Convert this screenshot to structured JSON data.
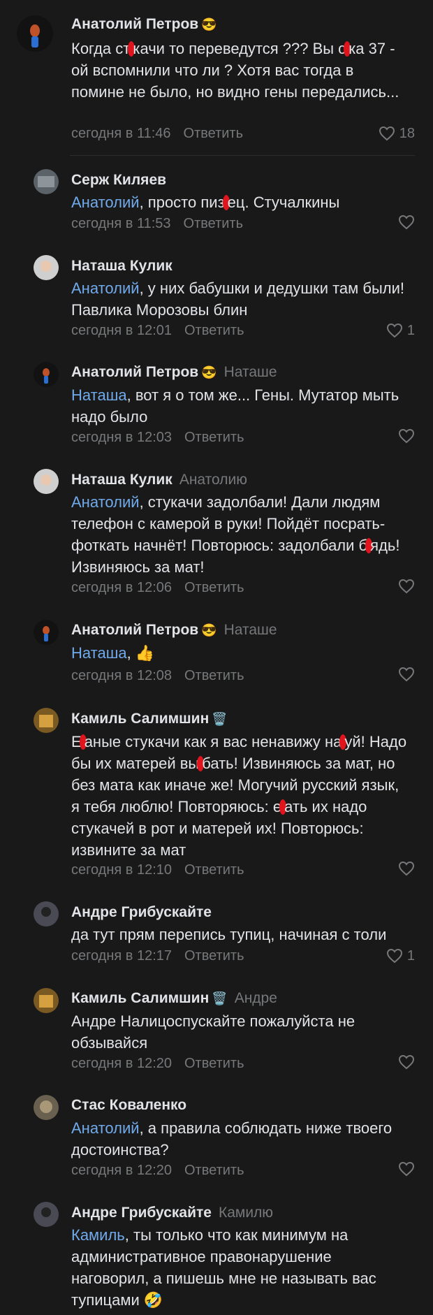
{
  "comments": [
    {
      "author": "Анатолий Петров",
      "badge": "😎",
      "reply_to": "",
      "mention": "",
      "text_before": "Когда ст",
      "redacted_a": "у",
      "text_mid": "качи то переведутся ??? Вы с",
      "redacted_b": "у",
      "text_after": "ка 37 - ой вспомнили что ли ? Хотя вас тогда в помине не было, но видно гены передались...",
      "time": "сегодня в 11:46",
      "answer": "Ответить",
      "likes": "18",
      "avatar": "user-avatar"
    },
    {
      "author": "Серж Киляев",
      "badge": "",
      "reply_to": "",
      "mention": "Анатолий",
      "text": ", просто пиз",
      "redacted": "д",
      "text_after": "ец. Стучалкины",
      "time": "сегодня в 11:53",
      "answer": "Ответить",
      "likes": "",
      "avatar": "user-avatar"
    },
    {
      "author": "Наташа Кулик",
      "badge": "",
      "reply_to": "",
      "mention": "Анатолий",
      "text": ", у них бабушки и дедушки там были! Павлика Морозовы блин",
      "time": "сегодня в 12:01",
      "answer": "Ответить",
      "likes": "1",
      "avatar": "user-avatar"
    },
    {
      "author": "Анатолий Петров",
      "badge": "😎",
      "reply_to": "Наташе",
      "mention": "Наташа",
      "text": ", вот я о том же... Гены. Мутатор мыть надо было",
      "time": "сегодня в 12:03",
      "answer": "Ответить",
      "likes": "",
      "avatar": "user-avatar"
    },
    {
      "author": "Наташа Кулик",
      "badge": "",
      "reply_to": "Анатолию",
      "mention": "Анатолий",
      "text": ", стукачи задолбали! Дали людям телефон с камерой в руки! Пойдёт посрать- фоткать начнёт! Повторюсь: задолбали б",
      "redacted": "л",
      "text_after": "ядь! Извиняюсь за мат!",
      "time": "сегодня в 12:06",
      "answer": "Ответить",
      "likes": "",
      "avatar": "user-avatar"
    },
    {
      "author": "Анатолий Петров",
      "badge": "😎",
      "reply_to": "Наташе",
      "mention": "Наташа",
      "text": ", 👍",
      "time": "сегодня в 12:08",
      "answer": "Ответить",
      "likes": "",
      "avatar": "user-avatar"
    },
    {
      "author": "Камиль Салимшин",
      "badge": "🗑️",
      "reply_to": "",
      "mention": "",
      "text": "Е",
      "redacted": "б",
      "text_after": "аные стукачи как я вас ненавижу на",
      "redacted2": "х",
      "text_after2": "уй! Надо бы их матерей вы",
      "redacted3": "е",
      "text_after3": "бать! Извиняюсь за мат, но без мата как иначе же! Могучий русский язык, я тебя люблю! Повторяюсь: е",
      "redacted4": "б",
      "text_after4": "ать их надо стукачей в рот и матерей их! Повторюсь: извините за мат",
      "time": "сегодня в 12:10",
      "answer": "Ответить",
      "likes": "",
      "avatar": "user-avatar"
    },
    {
      "author": "Андре Грибускайте",
      "badge": "",
      "reply_to": "",
      "mention": "",
      "text": "да тут прям перепись тупиц, начиная с толи",
      "time": "сегодня в 12:17",
      "answer": "Ответить",
      "likes": "1",
      "avatar": "user-avatar"
    },
    {
      "author": "Камиль Салимшин",
      "badge": "🗑️",
      "reply_to": "Андре",
      "mention": "",
      "text": "Андре Налицоспускайте пожалуйста не обзывайся",
      "time": "сегодня в 12:20",
      "answer": "Ответить",
      "likes": "",
      "avatar": "user-avatar"
    },
    {
      "author": "Стас Коваленко",
      "badge": "",
      "reply_to": "",
      "mention": "Анатолий",
      "text": ", а правила соблюдать ниже твоего достоинства?",
      "time": "сегодня в 12:20",
      "answer": "Ответить",
      "likes": "",
      "avatar": "user-avatar"
    },
    {
      "author": "Андре Грибускайте",
      "badge": "",
      "reply_to": "Камилю",
      "mention": "Камиль",
      "text": ", ты только что как минимум на административное правонарушение наговорил, а пишешь мне не называть вас тупицами 🤣",
      "time": "",
      "answer": "",
      "likes": "",
      "avatar": "user-avatar"
    }
  ],
  "icons": {
    "like": "heart-outline-icon"
  },
  "colors": {
    "background": "#19191a",
    "mention": "#71aaeb",
    "secondary": "#76787a",
    "text": "#e1e3e6",
    "redaction": "#e0141c"
  }
}
